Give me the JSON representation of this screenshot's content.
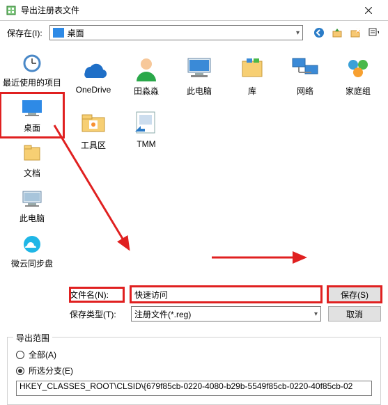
{
  "window": {
    "title": "导出注册表文件"
  },
  "toolbar": {
    "save_in_label": "保存在(I):",
    "location": "桌面"
  },
  "sidebar": {
    "items": [
      {
        "label": "最近使用的项目"
      },
      {
        "label": "桌面"
      },
      {
        "label": "文档"
      },
      {
        "label": "此电脑"
      },
      {
        "label": "微云同步盘"
      }
    ]
  },
  "grid": {
    "items": [
      {
        "label": "OneDrive"
      },
      {
        "label": "田淼淼"
      },
      {
        "label": "此电脑"
      },
      {
        "label": "库"
      },
      {
        "label": "网络"
      },
      {
        "label": "家庭组"
      },
      {
        "label": "工具区"
      },
      {
        "label": "TMM"
      }
    ]
  },
  "form": {
    "filename_label": "文件名(N):",
    "filename_value": "快速访问",
    "filetype_label": "保存类型(T):",
    "filetype_value": "注册文件(*.reg)",
    "save_btn": "保存(S)",
    "cancel_btn": "取消"
  },
  "export": {
    "group_title": "导出范围",
    "opt_all": "全部(A)",
    "opt_branch": "所选分支(E)",
    "path": "HKEY_CLASSES_ROOT\\CLSID\\{679f85cb-0220-4080-b29b-5549f85cb-0220-40f85cb-02"
  }
}
